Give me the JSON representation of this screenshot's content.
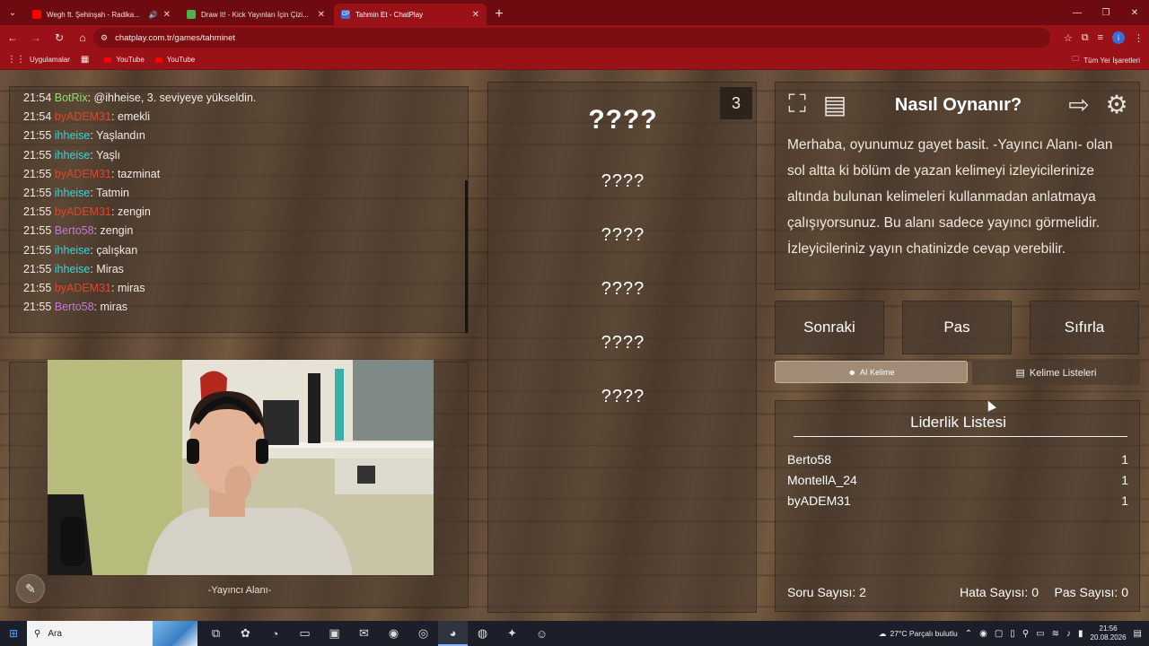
{
  "browser": {
    "tabs": [
      {
        "title": "Wegh ft. Şehinşah - Radika...",
        "favicon": "youtube-icon",
        "color": "#ff0000",
        "audio": true
      },
      {
        "title": "Draw It! - Kick Yayınları İçin Çizi...",
        "favicon": "drawit-icon",
        "color": "#4caf50"
      },
      {
        "title": "Tahmin Et - ChatPlay",
        "favicon": "chatplay-icon",
        "color": "#3a6dd8",
        "favicon_text": "CP",
        "active": true
      }
    ],
    "url": "chatplay.com.tr/games/tahminet",
    "bookmarks": {
      "apps": "Uygulamalar",
      "yt1": "YouTube",
      "yt2": "YouTube",
      "all": "Tüm Yer İşaretleri"
    },
    "profile_initial": "i"
  },
  "chat": [
    {
      "time": "21:54",
      "user": "BotRix",
      "color": "#8ee06a",
      "msg": ": @ihheise, 3. seviyeye yükseldin."
    },
    {
      "time": "21:54",
      "user": "byADEM31",
      "color": "#e0452c",
      "msg": ": emekli"
    },
    {
      "time": "21:55",
      "user": "ihheise",
      "color": "#3fd4d4",
      "msg": ": Yaşlandın"
    },
    {
      "time": "21:55",
      "user": "ihheise",
      "color": "#3fd4d4",
      "msg": ": Yaşlı"
    },
    {
      "time": "21:55",
      "user": "byADEM31",
      "color": "#e0452c",
      "msg": ": tazminat"
    },
    {
      "time": "21:55",
      "user": "ihheise",
      "color": "#3fd4d4",
      "msg": ": Tatmin"
    },
    {
      "time": "21:55",
      "user": "byADEM31",
      "color": "#e0452c",
      "msg": ": zengin"
    },
    {
      "time": "21:55",
      "user": "Berto58",
      "color": "#c77ad9",
      "msg": ": zengin"
    },
    {
      "time": "21:55",
      "user": "ihheise",
      "color": "#3fd4d4",
      "msg": ": çalışkan"
    },
    {
      "time": "21:55",
      "user": "ihheise",
      "color": "#3fd4d4",
      "msg": ": Miras"
    },
    {
      "time": "21:55",
      "user": "byADEM31",
      "color": "#e0452c",
      "msg": ": miras"
    },
    {
      "time": "21:55",
      "user": "Berto58",
      "color": "#c77ad9",
      "msg": ": miras"
    }
  ],
  "camera": {
    "label": "-Yayıncı Alanı-"
  },
  "game": {
    "counter": "3",
    "words": [
      "????",
      "????",
      "????",
      "????",
      "????",
      "????"
    ]
  },
  "howto": {
    "title": "Nasıl Oynanır?",
    "text": "Merhaba, oyunumuz gayet basit.  -Yayıncı Alanı- olan sol altta ki bölüm de yazan kelimeyi izleyicilerinize altında bulunan kelimeleri kullanmadan anlatmaya çalışıyorsunuz. Bu alanı sadece yayıncı görmelidir. İzleyicileriniz yayın chatinizde cevap verebilir."
  },
  "buttons": {
    "next": "Sonraki",
    "pass": "Pas",
    "reset": "Sıfırla",
    "ai": "AI Kelime",
    "lists": "Kelime Listeleri"
  },
  "leaderboard": {
    "title": "Liderlik Listesi",
    "rows": [
      {
        "name": "Berto58",
        "score": "1"
      },
      {
        "name": "MontellA_24",
        "score": "1"
      },
      {
        "name": "byADEM31",
        "score": "1"
      }
    ],
    "questions": "Soru Sayısı: 2",
    "errors": "Hata Sayısı: 0",
    "passes": "Pas Sayısı: 0"
  },
  "taskbar": {
    "search": "Ara",
    "weather": "27°C  Parçalı bulutlu",
    "time": "21:56",
    "date": "20.08.2026"
  }
}
